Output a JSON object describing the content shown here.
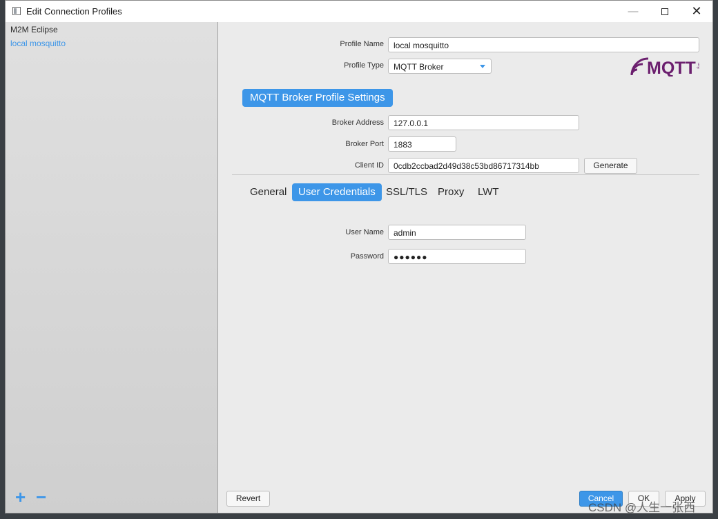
{
  "window": {
    "title": "Edit Connection Profiles"
  },
  "sidebar": {
    "profiles": [
      "M2M Eclipse",
      "local mosquitto"
    ],
    "add_label": "+",
    "remove_label": "−"
  },
  "form": {
    "profile_name_label": "Profile Name",
    "profile_name_value": "local mosquitto",
    "profile_type_label": "Profile Type",
    "profile_type_value": "MQTT Broker",
    "section_title": "MQTT Broker Profile Settings",
    "broker_address_label": "Broker Address",
    "broker_address_value": "127.0.0.1",
    "broker_port_label": "Broker Port",
    "broker_port_value": "1883",
    "client_id_label": "Client ID",
    "client_id_value": "0cdb2ccbad2d49d38c53bd86717314bb",
    "generate_label": "Generate"
  },
  "tabs": [
    {
      "label": "General",
      "active": false
    },
    {
      "label": "User Credentials",
      "active": true
    },
    {
      "label": "SSL/TLS",
      "active": false
    },
    {
      "label": "Proxy",
      "active": false
    },
    {
      "label": "LWT",
      "active": false
    }
  ],
  "credentials": {
    "user_name_label": "User Name",
    "user_name_value": "admin",
    "password_label": "Password",
    "password_value": "●●●●●●"
  },
  "footer": {
    "revert_label": "Revert",
    "cancel_label": "Cancel",
    "ok_label": "OK",
    "apply_label": "Apply"
  },
  "logo": {
    "text": "MQTT",
    "sub": "org"
  },
  "watermark": "CSDN @人生一张西",
  "colors": {
    "accent": "#3d96e8",
    "logo_purple": "#6b1f6e"
  }
}
